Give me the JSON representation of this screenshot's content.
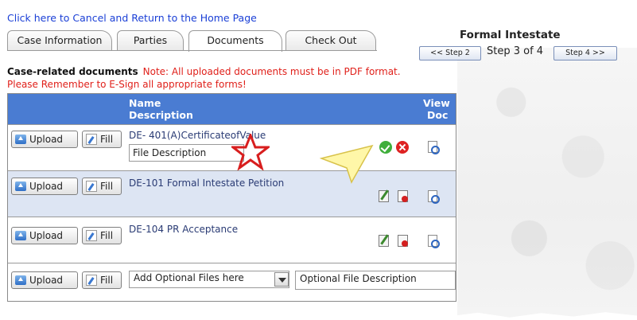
{
  "cancel_link": "Click here to Cancel and Return to the Home Page",
  "tabs": [
    {
      "label": "Case Information"
    },
    {
      "label": "Parties"
    },
    {
      "label": "Documents"
    },
    {
      "label": "Check Out"
    }
  ],
  "form_title": "Formal Intestate",
  "steps": {
    "prev": "<< Step 2",
    "current": "Step 3 of 4",
    "next": "Step 4 >>"
  },
  "notices": {
    "heading": "Case-related documents",
    "pdf_note": "Note: All uploaded documents must be in PDF format.",
    "esign_note": "Please Remember to E-Sign all appropriate forms!"
  },
  "table_headers": {
    "name": "Name",
    "description": "Description",
    "view": "View",
    "doc": "Doc"
  },
  "buttons": {
    "upload": "Upload",
    "fill": "Fill"
  },
  "documents": [
    {
      "name": "DE- 401(A)CertificateofValue",
      "description_value": "File Description"
    },
    {
      "name": "DE-101 Formal Intestate Petition"
    },
    {
      "name": "DE-104 PR Acceptance"
    }
  ],
  "optional_row": {
    "select_value": "Add Optional Files here",
    "description_value": "Optional File Description"
  },
  "colors": {
    "header": "#4a7cd2",
    "alt_row": "#dde5f3",
    "link": "#1a3fd6",
    "warning": "#e0201a"
  }
}
